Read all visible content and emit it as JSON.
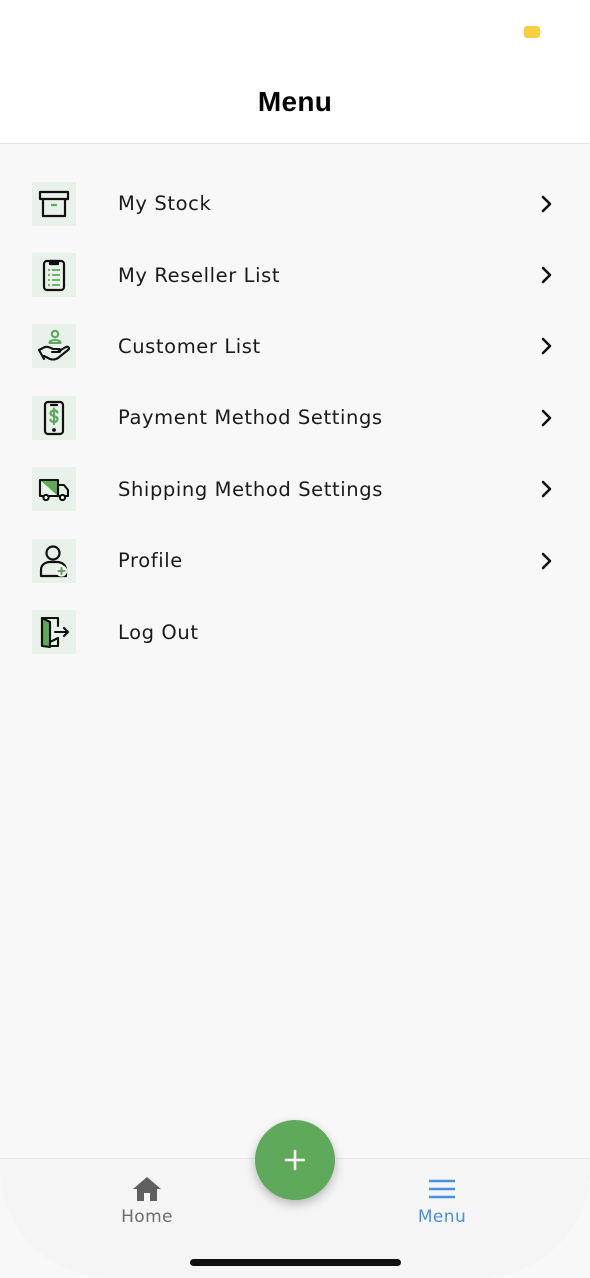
{
  "header": {
    "title": "Menu"
  },
  "menu_items": [
    {
      "label": "My Stock",
      "icon": "archive-box-icon",
      "has_chevron": true
    },
    {
      "label": "My Reseller List",
      "icon": "clipboard-list-icon",
      "has_chevron": true
    },
    {
      "label": "Customer List",
      "icon": "hand-user-icon",
      "has_chevron": true
    },
    {
      "label": "Payment Method Settings",
      "icon": "phone-dollar-icon",
      "has_chevron": true
    },
    {
      "label": "Shipping Method Settings",
      "icon": "delivery-truck-icon",
      "has_chevron": true
    },
    {
      "label": "Profile",
      "icon": "user-add-icon",
      "has_chevron": true
    },
    {
      "label": "Log Out",
      "icon": "logout-door-icon",
      "has_chevron": false
    }
  ],
  "bottom_nav": {
    "home_label": "Home",
    "menu_label": "Menu",
    "active": "Menu"
  },
  "fab": {
    "icon": "plus-icon"
  },
  "colors": {
    "accent_green": "#5eaa5a",
    "icon_bg": "#e9f2ea",
    "active_nav": "#4a90e2",
    "inactive_nav": "#6d6d6d",
    "status_indicator": "#f5d142"
  }
}
